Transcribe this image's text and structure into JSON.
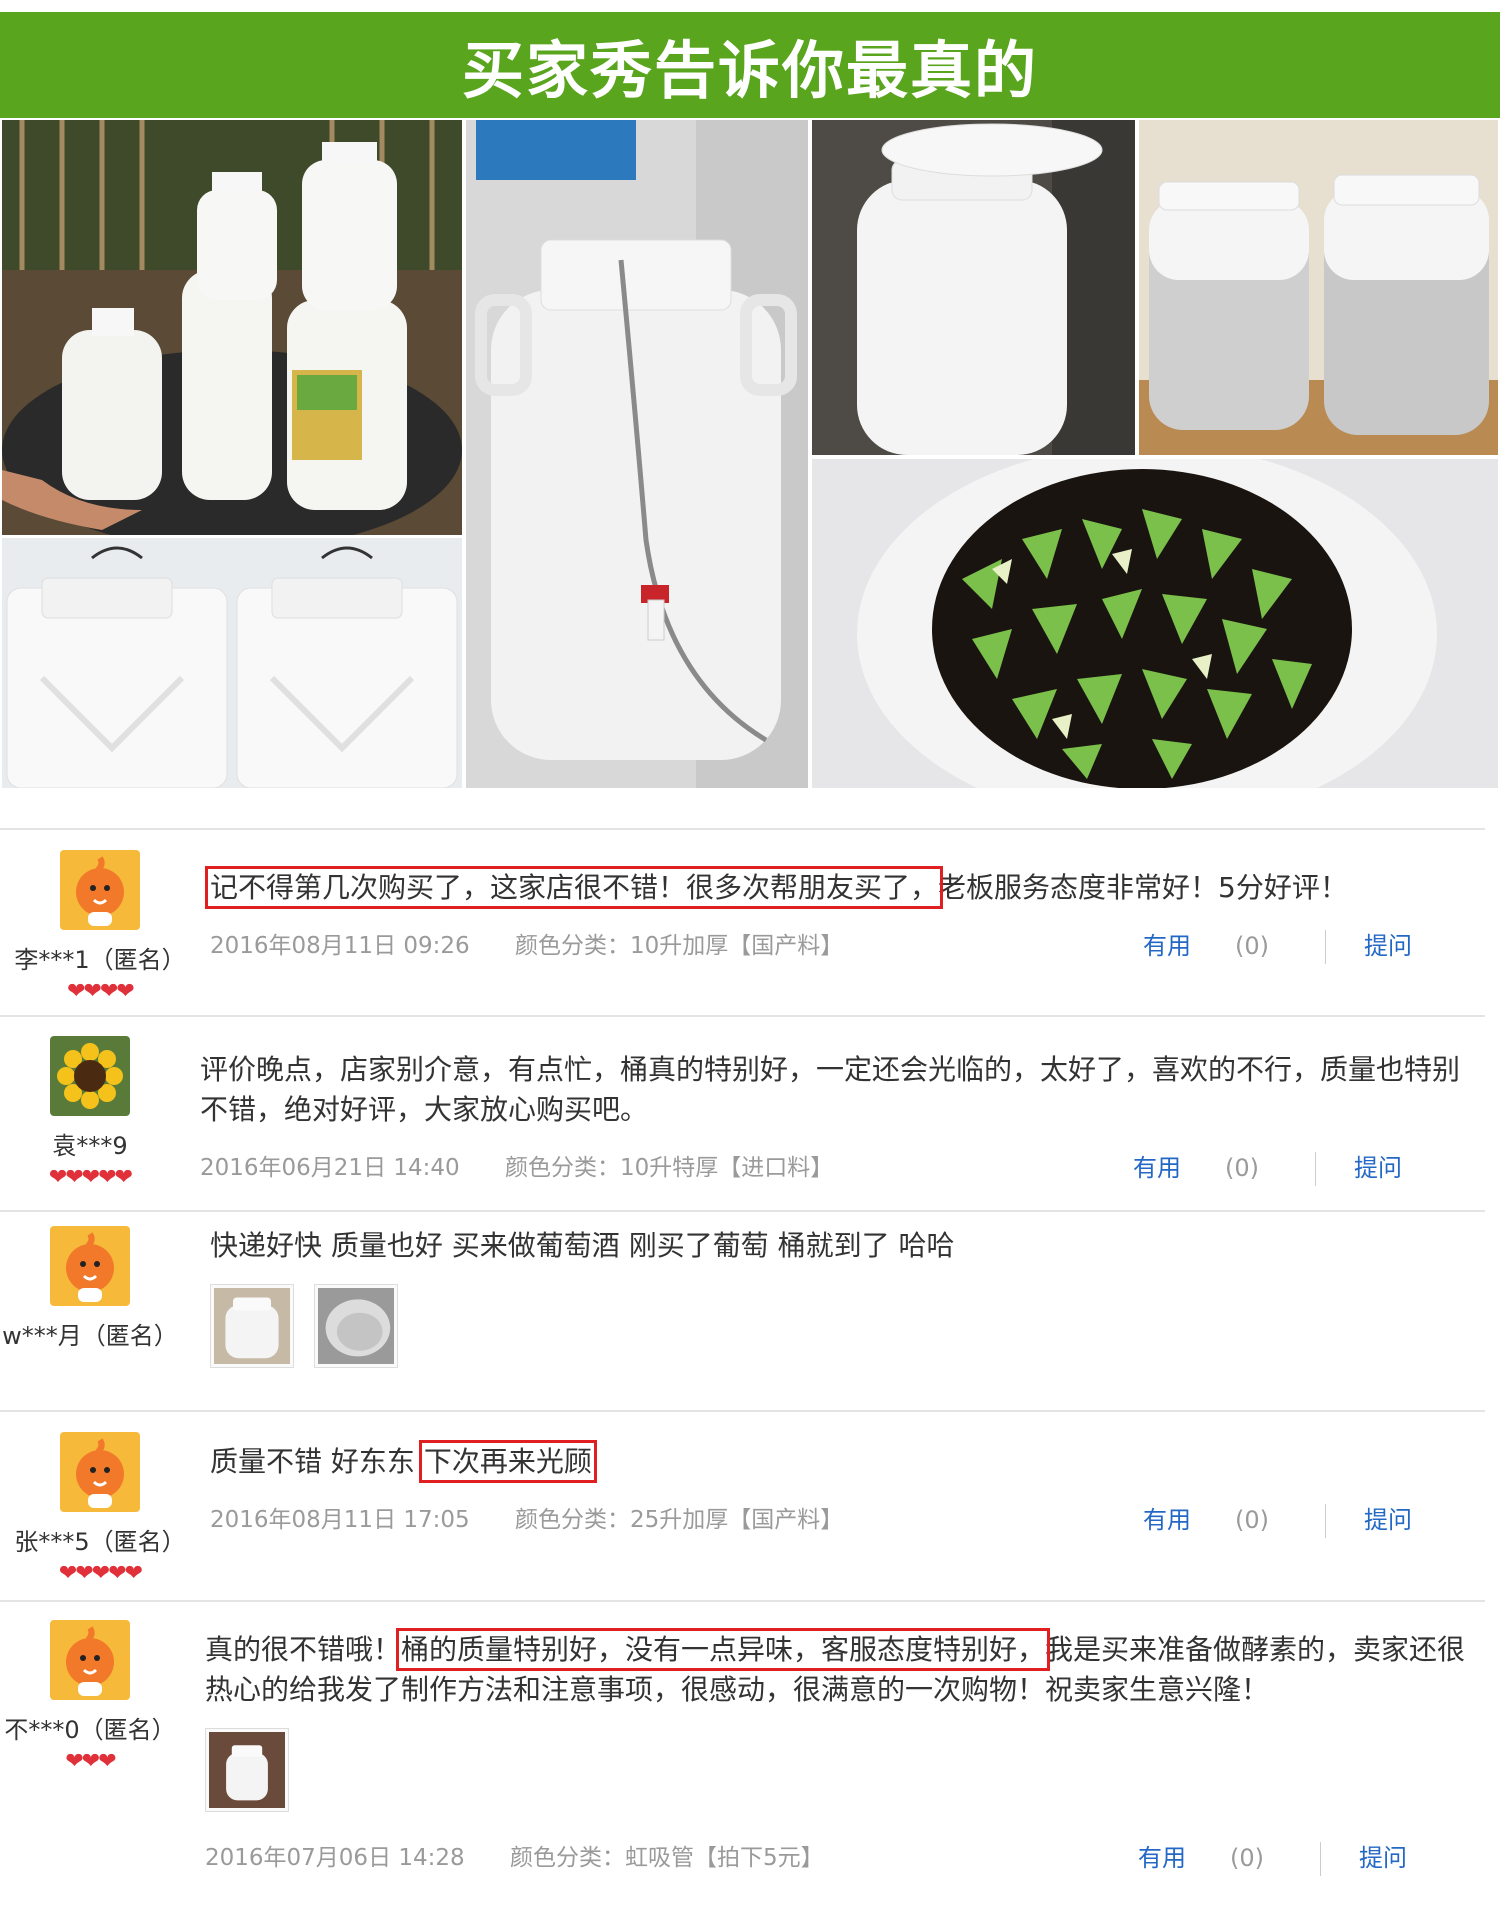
{
  "banner": {
    "title": "买家秀告诉你最真的"
  },
  "reviews": [
    {
      "user": "李***1（匿名）",
      "hearts": "❤❤❤❤",
      "text_hl": "记不得第几次购买了，这家店很不错！很多次帮朋友买了，",
      "text_rest": "老板服务态度非常好！5分好评！",
      "date": "2016年08月11日 09:26",
      "spec": "颜色分类：10升加厚【国产料】",
      "useful": "有用",
      "count": "(0)",
      "ask": "提问"
    },
    {
      "user": "袁***9",
      "hearts": "❤❤❤❤❤",
      "text": "评价晚点，店家别介意，有点忙，桶真的特别好，一定还会光临的，太好了，喜欢的不行，质量也特别不错，绝对好评，大家放心购买吧。",
      "date": "2016年06月21日 14:40",
      "spec": "颜色分类：10升特厚【进口料】",
      "useful": "有用",
      "count": "(0)",
      "ask": "提问"
    },
    {
      "user": "w***月（匿名）",
      "text": "快递好快 质量也好 买来做葡萄酒 刚买了葡萄 桶就到了 哈哈"
    },
    {
      "user": "张***5（匿名）",
      "hearts": "❤❤❤❤❤",
      "text_pre": "质量不错 好东东 ",
      "text_hl": "下次再来光顾",
      "date": "2016年08月11日 17:05",
      "spec": "颜色分类：25升加厚【国产料】",
      "useful": "有用",
      "count": "(0)",
      "ask": "提问"
    },
    {
      "user": "不***0（匿名）",
      "hearts": "❤❤❤",
      "text_pre": "真的很不错哦！",
      "text_hl": "桶的质量特别好，没有一点异味，客服态度特别好，",
      "text_rest": "我是买来准备做酵素的，卖家还很热心的给我发了制作方法和注意事项，很感动，很满意的一次购物！祝卖家生意兴隆！",
      "date": "2016年07月06日 14:28",
      "spec": "颜色分类：虹吸管【拍下5元】",
      "useful": "有用",
      "count": "(0)",
      "ask": "提问"
    }
  ],
  "colors": {
    "banner": "#59a51e",
    "link": "#2468c6",
    "highlight": "#e02020",
    "meta": "#9a9a9a"
  }
}
